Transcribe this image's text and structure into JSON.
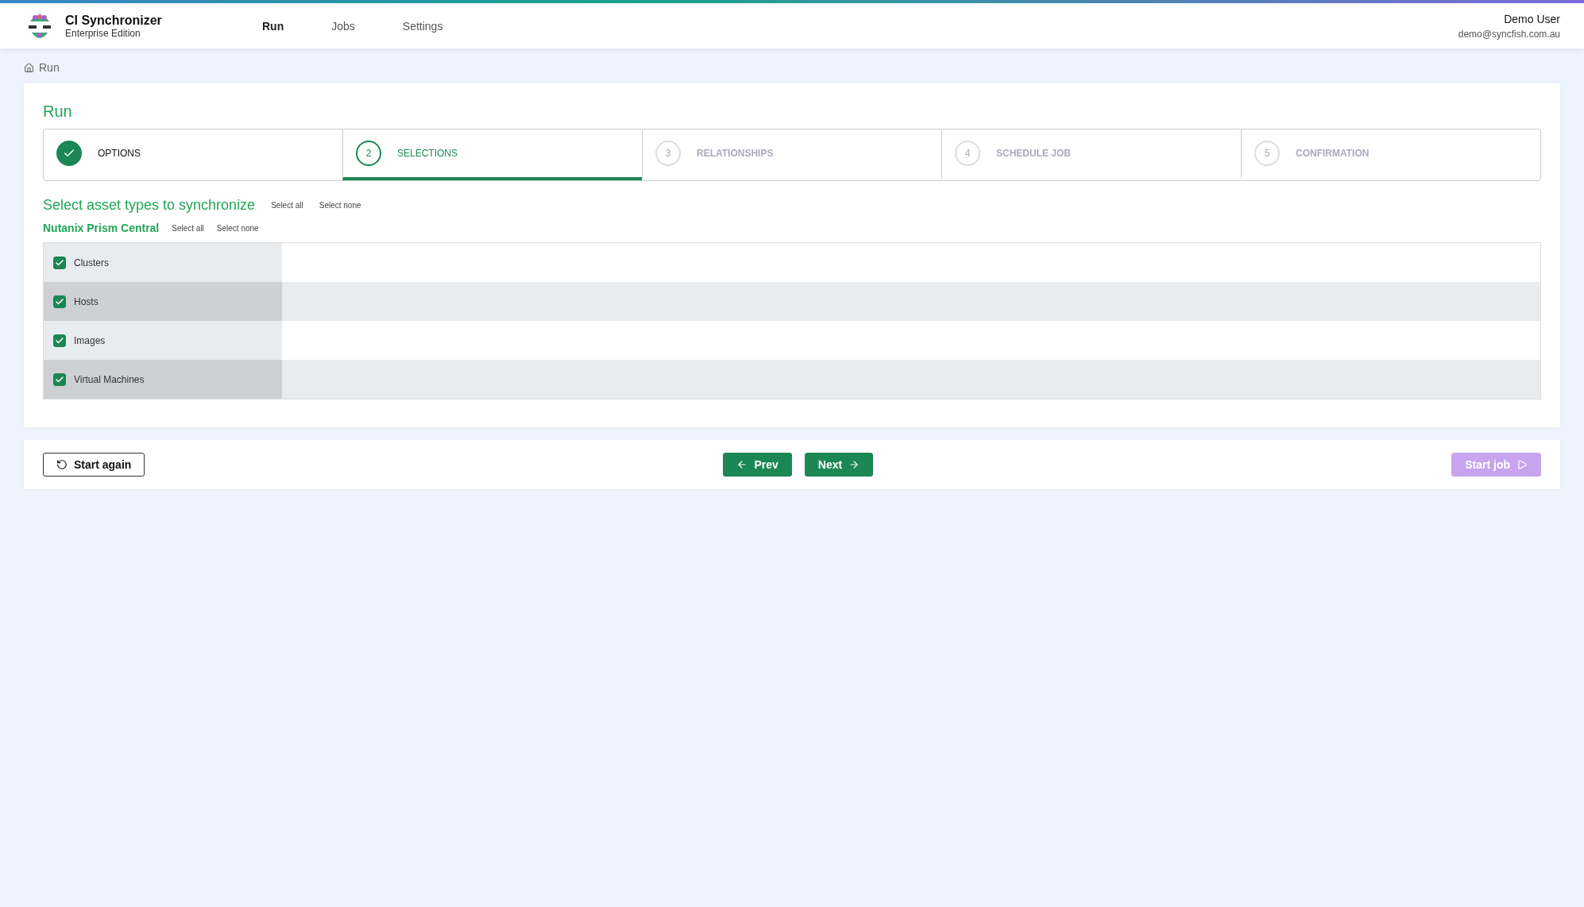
{
  "app": {
    "title": "CI Synchronizer",
    "edition": "Enterprise Edition"
  },
  "nav": [
    {
      "label": "Run",
      "selected": true
    },
    {
      "label": "Jobs",
      "selected": false
    },
    {
      "label": "Settings",
      "selected": false
    }
  ],
  "user": {
    "name": "Demo User",
    "email": "demo@syncfish.com.au"
  },
  "breadcrumb": [
    "Run"
  ],
  "page_title": "Run",
  "steps": [
    {
      "label": "OPTIONS",
      "completed": true,
      "selected": false
    },
    {
      "number": "2",
      "label": "SELECTIONS",
      "completed": false,
      "selected": true
    },
    {
      "number": "3",
      "label": "RELATIONSHIPS",
      "completed": false,
      "selected": false
    },
    {
      "number": "4",
      "label": "SCHEDULE JOB",
      "completed": false,
      "selected": false
    },
    {
      "number": "5",
      "label": "CONFIRMATION",
      "completed": false,
      "selected": false
    }
  ],
  "section": {
    "title": "Select asset types to synchronize",
    "select_all": "Select all",
    "select_none": "Select none"
  },
  "groups": [
    {
      "title": "Nutanix Prism Central",
      "select_all": "Select all",
      "select_none": "Select none",
      "items": [
        {
          "label": "Clusters",
          "checked": true
        },
        {
          "label": "Hosts",
          "checked": true
        },
        {
          "label": "Images",
          "checked": true
        },
        {
          "label": "Virtual Machines",
          "checked": true
        }
      ]
    }
  ],
  "actions": {
    "start_again": "Start again",
    "prev": "Prev",
    "next": "Next",
    "start_job": {
      "label": "Start job",
      "disabled": true
    }
  }
}
